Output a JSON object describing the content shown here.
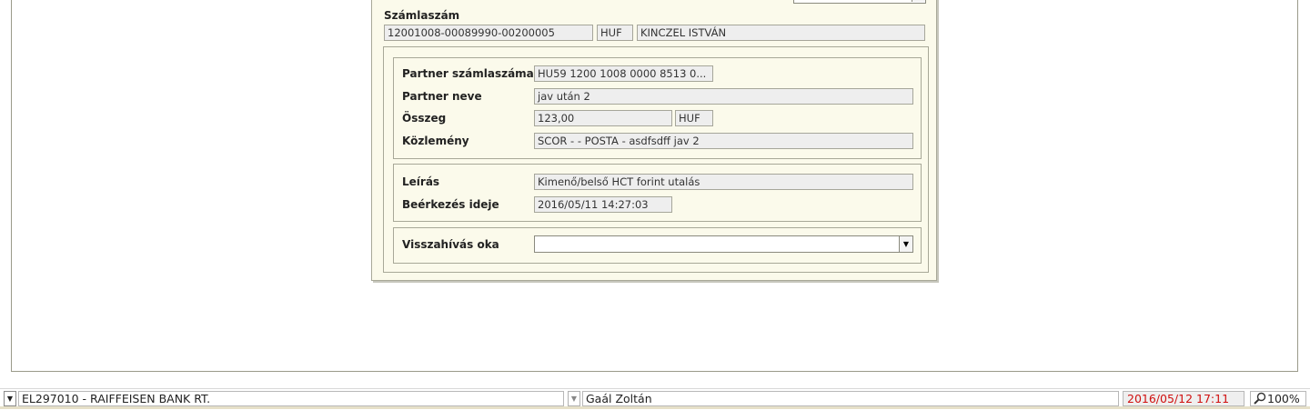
{
  "account": {
    "label": "Számlaszám",
    "number": "12001008-00089990-00200005",
    "currency": "HUF",
    "owner": "KINCZEL ISTVÁN"
  },
  "partner": {
    "account_label": "Partner számlaszáma",
    "account_value": "HU59 1200 1008 0000 8513 0...",
    "name_label": "Partner neve",
    "name_value": "jav után 2",
    "amount_label": "Összeg",
    "amount_value": "123,00",
    "amount_currency": "HUF",
    "reference_label": "Közlemény",
    "reference_value": "SCOR -  - POSTA - asdfsdff jav 2"
  },
  "details": {
    "description_label": "Leírás",
    "description_value": "Kimenő/belső HCT forint utalás",
    "arrival_label": "Beérkezés ideje",
    "arrival_value": "2016/05/11 14:27:03"
  },
  "recall": {
    "reason_label": "Visszahívás oka",
    "reason_value": ""
  },
  "statusbar": {
    "bank": "EL297010 - RAIFFEISEN BANK RT.",
    "user": "Gaál Zoltán",
    "datetime": "2016/05/12 17:11",
    "zoom": "100%"
  },
  "colors": {
    "dialog_bg": "#fbfaeb",
    "field_bg": "#eeeeee",
    "datetime_text": "#d01010",
    "datetime_bg": "#efefef"
  },
  "icons": {
    "dropdown": "triangle-down",
    "zoom": "magnifier"
  }
}
